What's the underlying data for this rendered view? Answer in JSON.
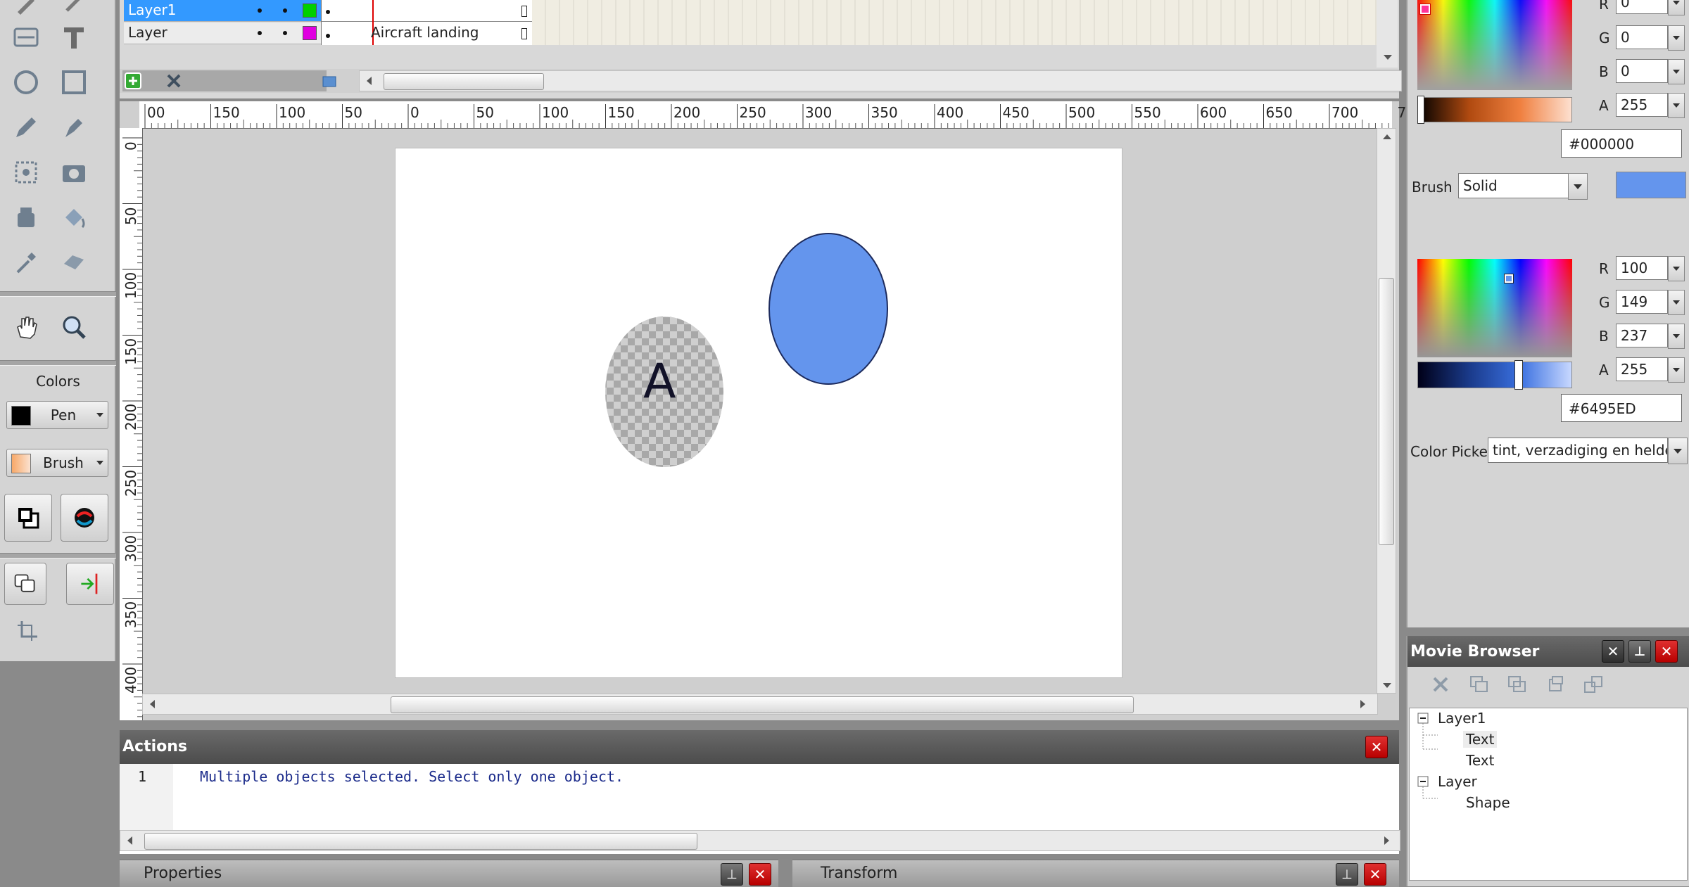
{
  "timeline": {
    "layers": [
      {
        "name": "Layer1",
        "color": "#00d000",
        "selected": true
      },
      {
        "name": "Layer",
        "color": "#e000e0",
        "selected": false
      }
    ],
    "frame_label": "Aircraft landing"
  },
  "ruler": {
    "h_ticks": [
      "00",
      "150",
      "100",
      "50",
      "0",
      "50",
      "100",
      "150",
      "200",
      "250",
      "300",
      "350",
      "400",
      "450",
      "500",
      "550",
      "600",
      "650",
      "700",
      "7"
    ],
    "v_ticks": [
      "0",
      "50",
      "100",
      "150",
      "200",
      "250",
      "300",
      "350",
      "400"
    ]
  },
  "stage": {
    "text_glyph": "A",
    "ellipse_fill": "#6495ED"
  },
  "tools": {
    "colors_label": "Colors",
    "pen_label": "Pen",
    "brush_label": "Brush"
  },
  "actions": {
    "title": "Actions",
    "line_number": "1",
    "message": "Multiple objects selected. Select only one object."
  },
  "pen_color": {
    "r": "0",
    "g": "0",
    "b": "0",
    "a": "255",
    "hex": "#000000",
    "r_label": "R",
    "g_label": "G",
    "b_label": "B",
    "a_label": "A"
  },
  "brush": {
    "label": "Brush",
    "type": "Solid",
    "swatch": "#6495ED"
  },
  "brush_color": {
    "r": "100",
    "g": "149",
    "b": "237",
    "a": "255",
    "hex": "#6495ED",
    "r_label": "R",
    "g_label": "G",
    "b_label": "B",
    "a_label": "A"
  },
  "color_picker": {
    "label": "Color Picker",
    "value": "tint, verzadiging en helde"
  },
  "movie_browser": {
    "title": "Movie Browser",
    "tree": [
      {
        "label": "Layer1",
        "depth": 0
      },
      {
        "label": "Text",
        "depth": 1
      },
      {
        "label": "Text",
        "depth": 1
      },
      {
        "label": "Layer",
        "depth": 0
      },
      {
        "label": "Shape",
        "depth": 1
      }
    ]
  },
  "bottom": {
    "properties": "Properties",
    "transform": "Transform"
  }
}
